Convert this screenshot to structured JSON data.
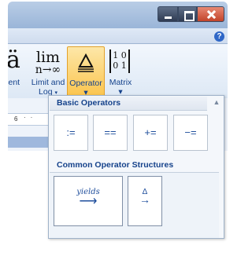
{
  "window": {
    "controls": {
      "minimize_icon": "minimize-icon",
      "maximize_icon": "maximize-icon",
      "close_icon": "close-icon"
    },
    "help_icon": "?"
  },
  "ribbon": {
    "accent": {
      "glyph": "ä",
      "label": "ccent"
    },
    "limit_log": {
      "glyph_top": "lim",
      "glyph_bottom": "n→∞",
      "label_line1": "Limit and",
      "label_line2": "Log"
    },
    "operator": {
      "label": "Operator"
    },
    "matrix": {
      "glyph_row1": "1 0",
      "glyph_row2": "0 1",
      "label": "Matrix"
    },
    "dropdown_arrow": "▾"
  },
  "ruler": {
    "number": "6"
  },
  "gallery": {
    "basic_operators": {
      "title": "Basic Operators",
      "items": [
        ":=",
        "==",
        "+=",
        "−="
      ]
    },
    "common_operator_structures": {
      "title": "Common Operator Structures",
      "items": [
        {
          "top": "yields",
          "arrow": "⟶"
        },
        {
          "top": "Δ",
          "arrow": "→"
        }
      ]
    }
  },
  "colors": {
    "accent_label": "#15428b",
    "operator_highlight": "#fbc54f",
    "close_button": "#c2432a"
  }
}
